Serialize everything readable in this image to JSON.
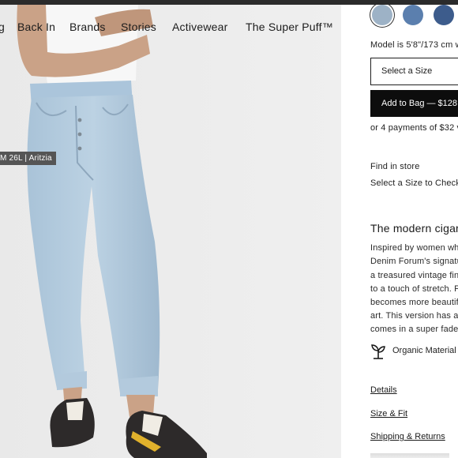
{
  "nav": {
    "items": [
      "g",
      "Back In",
      "Brands",
      "Stories",
      "Activewear",
      "The Super Puff™"
    ]
  },
  "photo": {
    "caption": "M 26L | Aritzia"
  },
  "product": {
    "swatch_colors": [
      "#9db2c6",
      "#5b7fae",
      "#3d5c8c"
    ],
    "model_info": "Model is 5'8\"/173 cm we",
    "size_select_label": "Select a Size",
    "add_to_bag_label": "Add to Bag — $128",
    "payments_text": "or 4 payments of $32 v",
    "find_in_store": "Find in store",
    "select_size_check": "Select a Size to Check",
    "headline": "The modern cigar",
    "description_lines": [
      "Inspired by women wh",
      "Denim Forum's signatu",
      "a treasured vintage fin",
      "to a touch of stretch. F",
      "becomes more beautif",
      "art. This version has a",
      "comes in a super fadeo"
    ],
    "organic_label": "Organic Material",
    "links": [
      "Details",
      "Size & Fit",
      "Shipping & Returns"
    ]
  },
  "icons": {
    "organic": "sprout-icon"
  }
}
